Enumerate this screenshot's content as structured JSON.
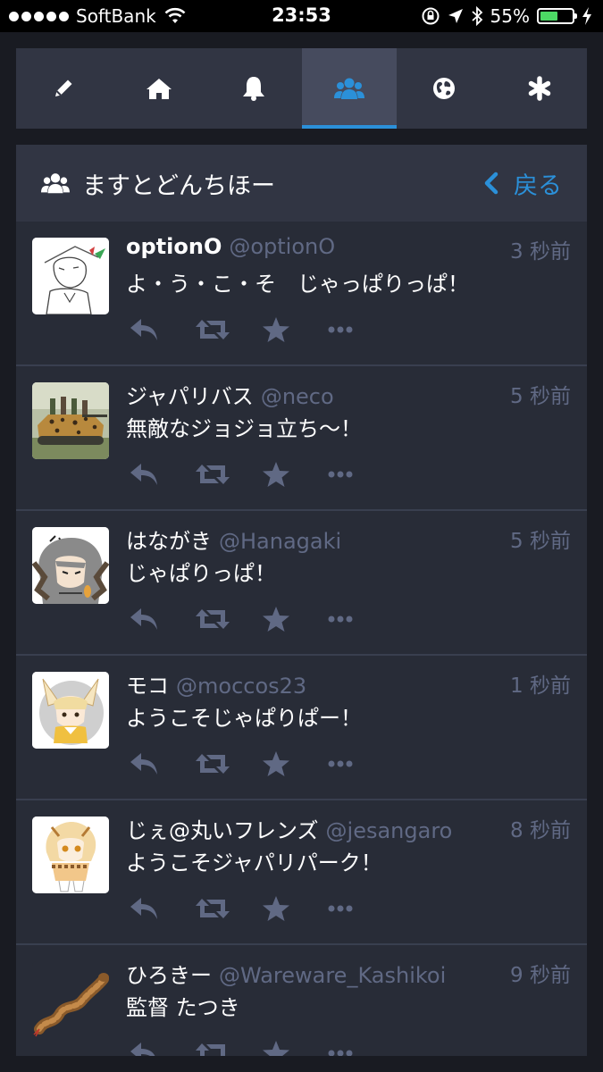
{
  "status_bar": {
    "carrier": "SoftBank",
    "time": "23:53",
    "battery": "55%",
    "battery_level": 0.55
  },
  "nav_tabs": [
    {
      "icon": "pencil-icon",
      "active": false
    },
    {
      "icon": "home-icon",
      "active": false
    },
    {
      "icon": "bell-icon",
      "active": false
    },
    {
      "icon": "users-icon",
      "active": true
    },
    {
      "icon": "globe-icon",
      "active": false
    },
    {
      "icon": "asterisk-icon",
      "active": false
    }
  ],
  "column": {
    "icon": "users-icon",
    "title": "ますとどんちほー",
    "back_label": "戻る"
  },
  "statuses": [
    {
      "display_name": "optionO",
      "acct": "@optionO",
      "time": "3 秒前",
      "content": "よ・う・こ・そ　じゃっぱりっぱ！"
    },
    {
      "display_name": "ジャパリバス",
      "acct": "@neco",
      "time": "5 秒前",
      "content": "無敵なジョジョ立ち〜！"
    },
    {
      "display_name": "はながき",
      "acct": "@Hanagaki",
      "time": "5 秒前",
      "content": "じゃぱりっぱ！"
    },
    {
      "display_name": "モコ",
      "acct": "@moccos23",
      "time": "1 秒前",
      "content": "ようこそじゃぱりぱー！"
    },
    {
      "display_name": "じぇ@丸いフレンズ",
      "acct": "@jesangaro",
      "time": "8 秒前",
      "content": "ようこそジャパリパーク！"
    },
    {
      "display_name": "ひろきー",
      "acct": "@Wareware_Kashikoi",
      "time": "9 秒前",
      "content": "監督 たつき"
    }
  ],
  "colors": {
    "accent": "#2b90d9",
    "muted": "#606984",
    "panel": "#282c37",
    "header": "#313543",
    "background": "#191b22"
  }
}
